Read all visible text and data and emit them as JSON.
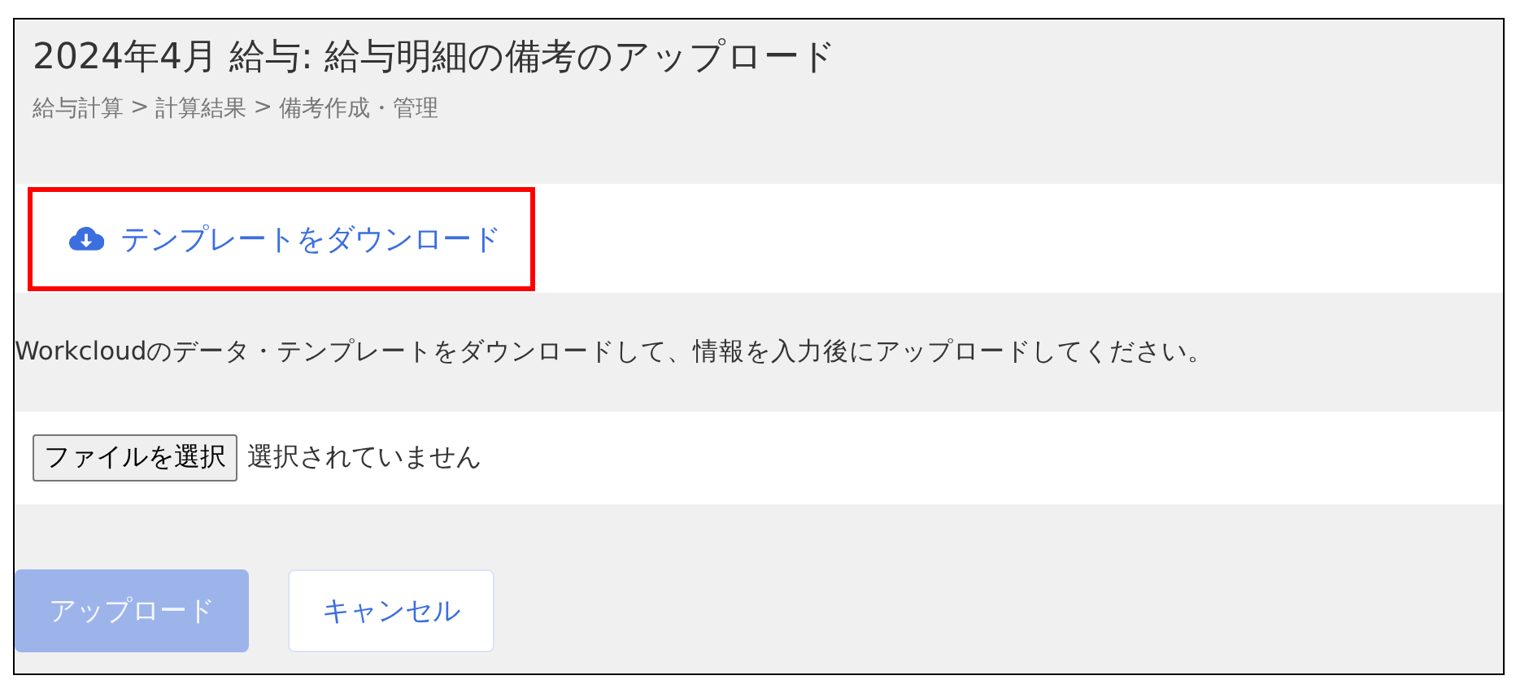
{
  "title": "2024年4月 給与: 給与明細の備考のアップロード",
  "breadcrumb": [
    "給与計算",
    "計算結果",
    "備考作成・管理"
  ],
  "breadcrumb_separator": ">",
  "download_link": {
    "label": "テンプレートをダウンロード",
    "highlighted": true
  },
  "description": "Workcloudのデータ・テンプレートをダウンロードして、情報を入力後にアップロードしてください。",
  "file_input": {
    "button": "ファイルを選択",
    "status": "選択されていません"
  },
  "buttons": [
    {
      "label": "アップロード",
      "kind": "primary",
      "disabled": true
    },
    {
      "label": "キャンセル",
      "kind": "secondary",
      "disabled": false
    }
  ]
}
